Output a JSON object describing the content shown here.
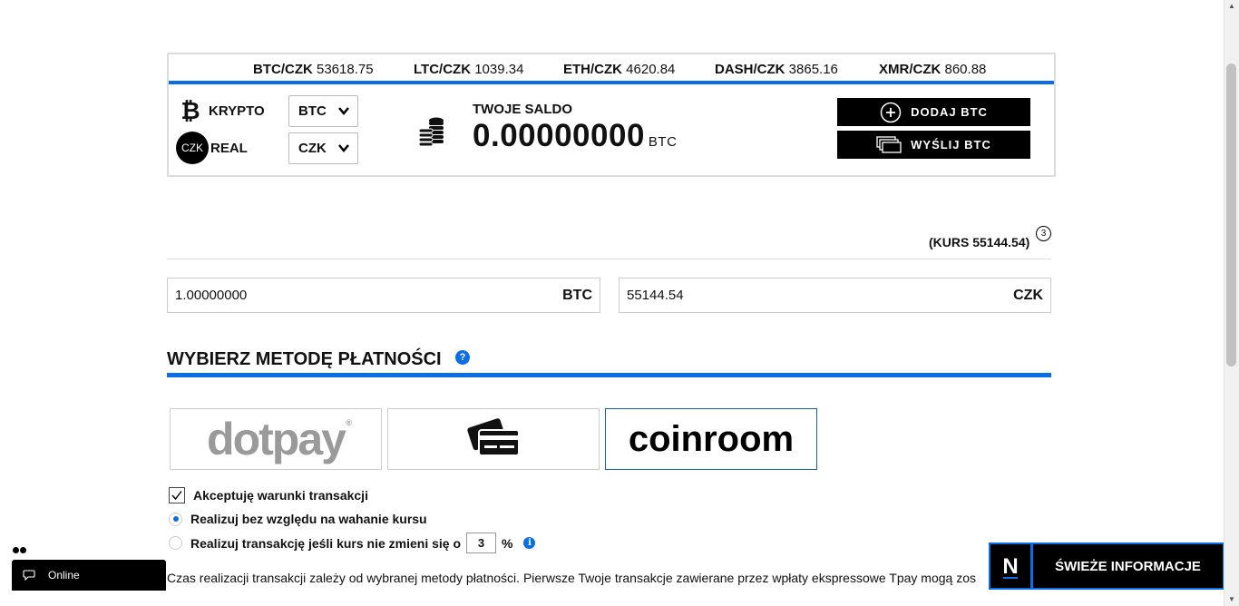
{
  "ticker": [
    {
      "pair": "BTC/CZK",
      "rate": "53618.75"
    },
    {
      "pair": "LTC/CZK",
      "rate": "1039.34"
    },
    {
      "pair": "ETH/CZK",
      "rate": "4620.84"
    },
    {
      "pair": "DASH/CZK",
      "rate": "3865.16"
    },
    {
      "pair": "XMR/CZK",
      "rate": "860.88"
    }
  ],
  "currency": {
    "crypto_label": "KRYPTO",
    "crypto_value": "BTC",
    "real_icon": "CZK",
    "real_label": "REAL",
    "real_value": "CZK"
  },
  "balance": {
    "label": "TWOJE SALDO",
    "value": "0.00000000",
    "unit": "BTC"
  },
  "actions": {
    "add_label": "DODAJ BTC",
    "send_label": "WYŚLIJ BTC"
  },
  "rate": {
    "label": "(KURS 55144.54)",
    "badge": "3"
  },
  "amounts": {
    "crypto_value": "1.00000000",
    "crypto_unit": "BTC",
    "fiat_value": "55144.54",
    "fiat_unit": "CZK"
  },
  "payment": {
    "title": "WYBIERZ METODĘ PŁATNOŚCI",
    "help": "?",
    "methods": [
      {
        "name": "dotpay",
        "reg": "®"
      },
      {
        "name": "card"
      },
      {
        "name": "coinroom",
        "selected": true
      }
    ]
  },
  "options": {
    "accept_terms": "Akceptuję warunki transakcji",
    "opt_ignore": "Realizuj bez względu na wahanie kursu",
    "opt_conditional": "Realizuj transakcję jeśli kurs nie zmieni się o",
    "percent_value": "3",
    "percent_sign": "%",
    "info": "i"
  },
  "description": "Czas realizacji transakcji zależy od wybranej metody płatności. Pierwsze Twoje transakcje zawierane przez wpłaty ekspressowe Tpay mogą zos",
  "chat": {
    "status": "Online"
  },
  "news": {
    "logo": "N",
    "label": "ŚWIEŻE INFORMACJE"
  },
  "colors": {
    "accent": "#0a6ee6",
    "dark": "#000000"
  }
}
